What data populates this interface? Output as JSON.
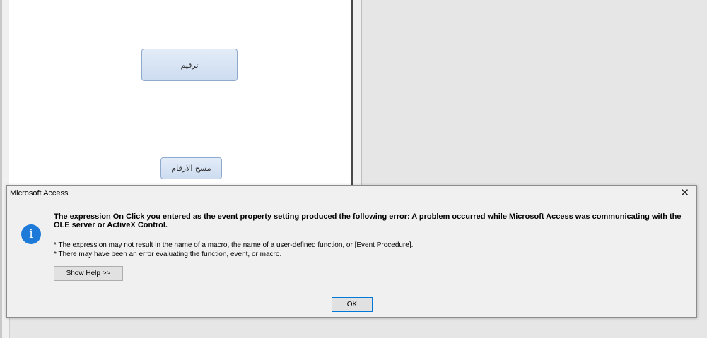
{
  "form": {
    "number_button_label": "ترقيم",
    "clear_button_label": "مسح الارقام"
  },
  "dialog": {
    "title": "Microsoft Access",
    "close_label": "✕",
    "icon": "info-icon",
    "message_main": "The expression On Click you entered as the event property setting produced the following error: A problem occurred while Microsoft Access was communicating with the OLE server or ActiveX Control.",
    "detail_line_1": "* The expression may not result in the name of a macro, the name of a user-defined function, or [Event Procedure].",
    "detail_line_2": "* There may have been an error evaluating the function, event, or macro.",
    "help_button_label": "Show Help >>",
    "ok_button_label": "OK",
    "icon_glyph": "i",
    "accent_color": "#1e7ad8"
  }
}
